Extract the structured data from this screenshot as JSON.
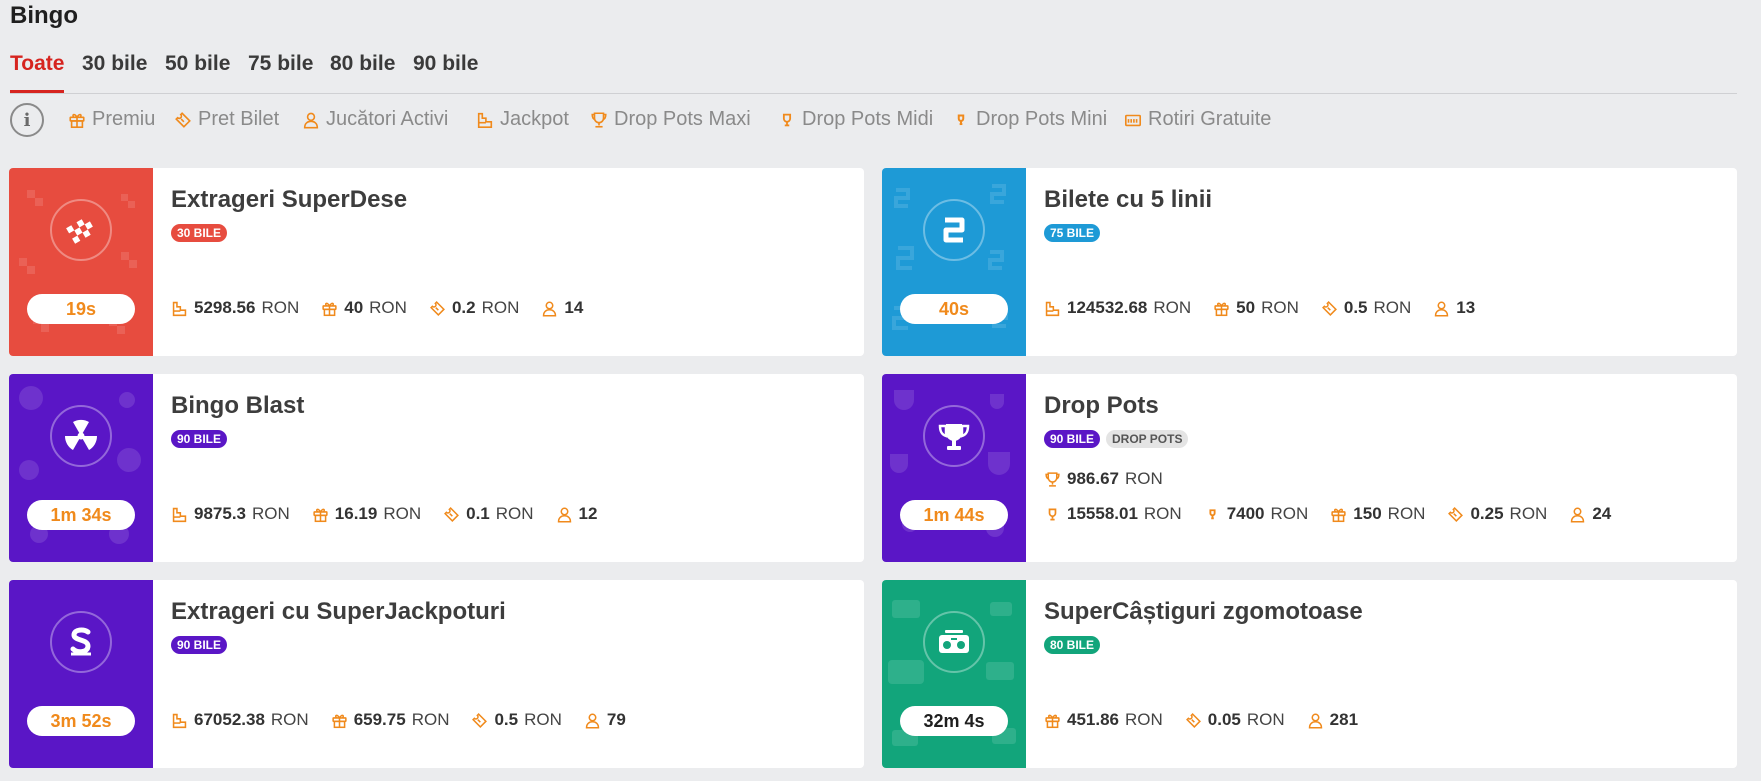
{
  "title": "Bingo",
  "tabs": [
    "Toate",
    "30 bile",
    "50 bile",
    "75 bile",
    "80 bile",
    "90 bile"
  ],
  "legend": {
    "info_icon": "i",
    "items": [
      "Premiu",
      "Pret Bilet",
      "Jucători Activi",
      "Jackpot",
      "Drop Pots Maxi",
      "Drop Pots Midi",
      "Drop Pots Mini",
      "Rotiri Gratuite"
    ]
  },
  "currency": "RON",
  "colors": {
    "accent": "#f08a1c",
    "active_tab": "#d6241f",
    "red": "#e74c3f",
    "blue": "#1e9ad6",
    "purple": "#5a16c6",
    "green": "#12a57b"
  },
  "cards": [
    {
      "name": "Extrageri SuperDese",
      "badge": "30 BILE",
      "badge_color": "#e74c3f",
      "timer": "19s",
      "color": "#e74c3f",
      "icon": "checkered-flag-icon",
      "jackpot": "5298.56",
      "prize": "40",
      "ticket": "0.2",
      "players": "14"
    },
    {
      "name": "Bilete cu 5 linii",
      "badge": "75 BILE",
      "badge_color": "#1e9ad6",
      "timer": "40s",
      "color": "#1e9ad6",
      "icon": "number-5-icon",
      "jackpot": "124532.68",
      "prize": "50",
      "ticket": "0.5",
      "players": "13"
    },
    {
      "name": "Bingo Blast",
      "badge": "90 BILE",
      "badge_color": "#5a16c6",
      "timer": "1m 34s",
      "color": "#5a16c6",
      "icon": "radiation-icon",
      "jackpot": "9875.3",
      "prize": "16.19",
      "ticket": "0.1",
      "players": "12"
    },
    {
      "name": "Drop Pots",
      "badge": "90 BILE",
      "badge_color": "#5a16c6",
      "badge2": "DROP POTS",
      "timer": "1m 44s",
      "color": "#5a16c6",
      "icon": "trophy-icon",
      "drop_maxi": "986.67",
      "drop_midi": "15558.01",
      "drop_mini": "7400",
      "prize": "150",
      "ticket": "0.25",
      "players": "24"
    },
    {
      "name": "Extrageri cu SuperJackpoturi",
      "badge": "90 BILE",
      "badge_color": "#5a16c6",
      "timer": "3m 52s",
      "color": "#5a16c6",
      "icon": "dollar-s-icon",
      "jackpot": "67052.38",
      "prize": "659.75",
      "ticket": "0.5",
      "players": "79"
    },
    {
      "name": "SuperCâștiguri zgomotoase",
      "badge": "80 BILE",
      "badge_color": "#12a57b",
      "timer": "32m 4s",
      "color": "#12a57b",
      "icon": "boombox-icon",
      "prize": "451.86",
      "ticket": "0.05",
      "players": "281"
    }
  ]
}
